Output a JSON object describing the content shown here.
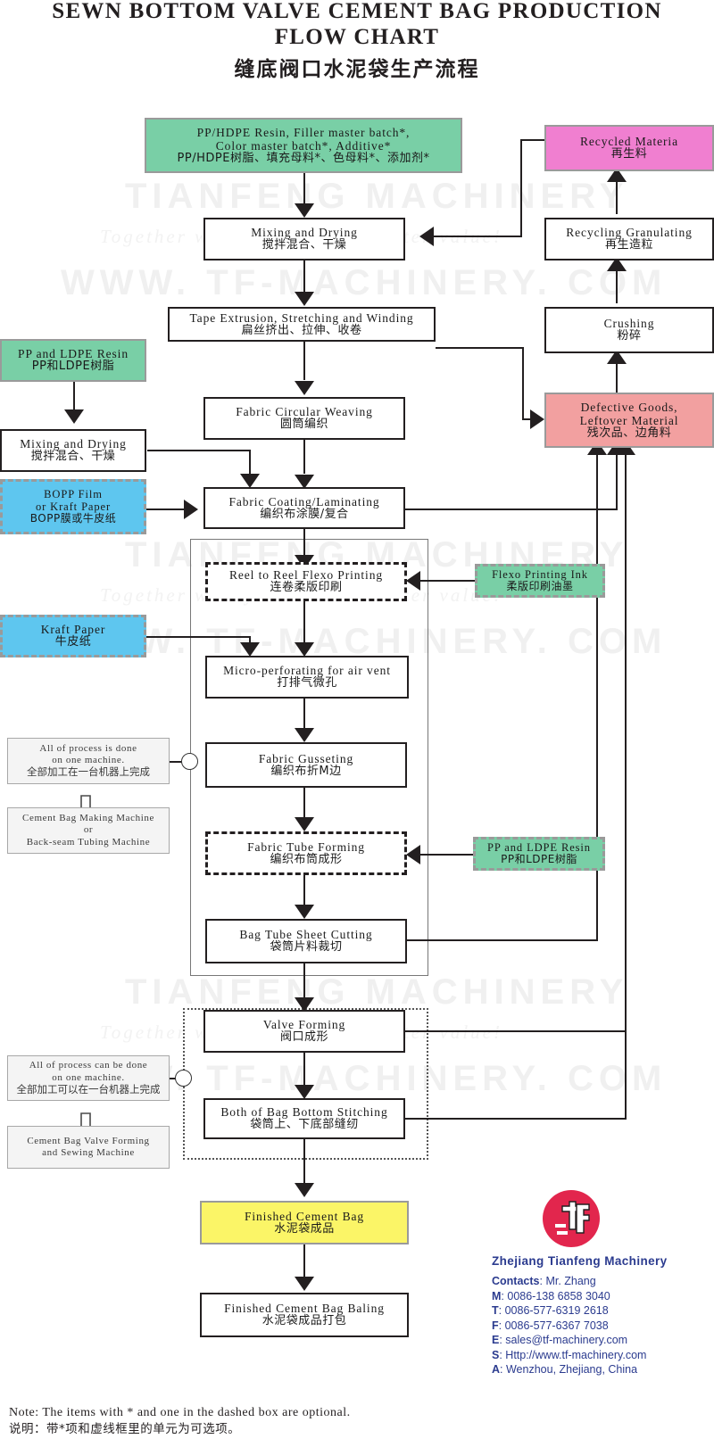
{
  "title": {
    "en_line1": "SEWN BOTTOM VALVE CEMENT BAG PRODUCTION",
    "en_line2": "FLOW CHART",
    "cn": "缝底阀口水泥袋生产流程"
  },
  "watermarks": {
    "line1": "TIANFENG MACHINERY",
    "line2": "Together with you to make better value!",
    "line3": "WWW. TF-MACHINERY. COM"
  },
  "colors": {
    "raw_material_green": "#79cfa6",
    "recycled_pink": "#f07fd0",
    "defective_salmon": "#f2a0a0",
    "film_blue": "#5ec6ef",
    "finished_yellow": "#fbf567",
    "line_black": "#231f20",
    "brand_blue": "#2b3b8f",
    "logo_red": "#e2264d"
  },
  "nodes": {
    "raw_resin": {
      "en1": "PP/HDPE Resin, Filler master batch*,",
      "en2": "Color master batch*, Additive*",
      "cn": "PP/HDPE树脂、填充母料*、色母料*、添加剂*",
      "type": "material",
      "optional": false
    },
    "mixing_drying_main": {
      "en": "Mixing and Drying",
      "cn": "搅拌混合、干燥",
      "type": "process"
    },
    "tape_extrusion": {
      "en": "Tape Extrusion, Stretching and Winding",
      "cn": "扁丝挤出、拉伸、收卷",
      "type": "process"
    },
    "circular_weaving": {
      "en": "Fabric Circular Weaving",
      "cn": "圆筒编织",
      "type": "process"
    },
    "coating_laminating": {
      "en": "Fabric Coating/Laminating",
      "cn": "编织布涂膜/复合",
      "type": "process"
    },
    "flexo_printing": {
      "en": "Reel to Reel Flexo Printing",
      "cn": "连卷柔版印刷",
      "type": "process",
      "optional": true
    },
    "micro_perforating": {
      "en": "Micro-perforating for air vent",
      "cn": "打排气微孔",
      "type": "process"
    },
    "fabric_gusseting": {
      "en": "Fabric Gusseting",
      "cn": "编织布折M边",
      "type": "process"
    },
    "tube_forming": {
      "en": "Fabric Tube Forming",
      "cn": "编织布筒成形",
      "type": "process",
      "optional": true
    },
    "sheet_cutting": {
      "en": "Bag Tube Sheet Cutting",
      "cn": "袋筒片料裁切",
      "type": "process"
    },
    "valve_forming": {
      "en": "Valve Forming",
      "cn": "阀口成形",
      "type": "process"
    },
    "bottom_stitching": {
      "en": "Both of Bag Bottom Stitching",
      "cn": "袋筒上、下底部缝纫",
      "type": "process"
    },
    "finished_bag": {
      "en": "Finished Cement Bag",
      "cn": "水泥袋成品",
      "type": "finished"
    },
    "bag_baling": {
      "en": "Finished Cement Bag Baling",
      "cn": "水泥袋成品打包",
      "type": "process"
    },
    "pp_ldpe_left": {
      "en": "PP and LDPE Resin",
      "cn": "PP和LDPE树脂",
      "type": "material"
    },
    "mixing_drying_left": {
      "en": "Mixing and Drying",
      "cn": "搅拌混合、干燥",
      "type": "process"
    },
    "bopp_film": {
      "en1": "BOPP Film",
      "en2": "or Kraft Paper",
      "cn": "BOPP膜或牛皮纸",
      "type": "material",
      "optional": true
    },
    "kraft_paper": {
      "en": "Kraft Paper",
      "cn": "牛皮纸",
      "type": "material",
      "optional": true
    },
    "flexo_ink": {
      "en": "Flexo Printing Ink",
      "cn": "柔版印刷油墨",
      "type": "material"
    },
    "pp_ldpe_right": {
      "en": "PP and LDPE Resin",
      "cn": "PP和LDPE树脂",
      "type": "material",
      "optional": true
    },
    "recycled_material": {
      "en": "Recycled Materia",
      "cn": "再生料",
      "type": "recycled"
    },
    "recycling_granulating": {
      "en": "Recycling Granulating",
      "cn": "再生造粒",
      "type": "process"
    },
    "crushing": {
      "en": "Crushing",
      "cn": "粉碎",
      "type": "process"
    },
    "defective_goods": {
      "en1": "Defective Goods,",
      "en2": "Leftover Material",
      "cn": "残次品、边角料",
      "type": "waste"
    }
  },
  "annotations": {
    "note1": {
      "en1": "All of process is done",
      "en2": "on one machine.",
      "cn": "全部加工在一台机器上完成"
    },
    "machine1": {
      "en1": "Cement Bag Making Machine",
      "en2": "or",
      "en3": "Back-seam Tubing Machine"
    },
    "note2": {
      "en1": "All of process can be done",
      "en2": "on one machine.",
      "cn": "全部加工可以在一台机器上完成"
    },
    "machine2": {
      "en1": "Cement Bag Valve Forming",
      "en2": "and Sewing Machine"
    }
  },
  "branding": {
    "logo_text": "tf",
    "company": "Zhejiang Tianfeng Machinery",
    "contacts": [
      {
        "label": "Contacts",
        "value": "Mr. Zhang"
      },
      {
        "label": "M",
        "value": "0086-138 6858 3040"
      },
      {
        "label": "T",
        "value": "0086-577-6319 2618"
      },
      {
        "label": "F",
        "value": "0086-577-6367 7038"
      },
      {
        "label": "E",
        "value": "sales@tf-machinery.com"
      },
      {
        "label": "S",
        "value": "Http://www.tf-machinery.com"
      },
      {
        "label": "A",
        "value": "Wenzhou, Zhejiang, China"
      }
    ]
  },
  "footer": {
    "note_en": "Note: The items with * and one in the dashed box are optional.",
    "note_cn": "说明：带*项和虚线框里的单元为可选项。"
  }
}
